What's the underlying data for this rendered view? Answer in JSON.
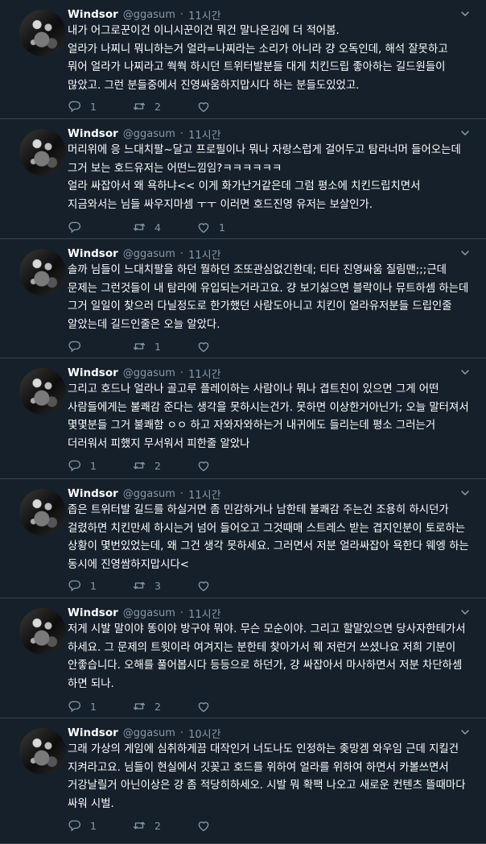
{
  "tweets": [
    {
      "name": "Windsor",
      "handle": "@ggasum",
      "dot": "·",
      "time": "11시간",
      "lines": [
        "내가 어그로꾼이건 이니시꾼이건 뭐건 말나온김에 더 적어봄.",
        "얼라가 나찌니 뭐니하는거 얼라=나찌라는 소리가 아니라 걍 오독인데, 해석 잘못하고 뭐어 얼라가 나찌라고 쒁쒁 하시던 트위터발분들 대게 치킨드립 좋아하는 길드원들이 많았고. 그런 분들중에서 진영싸움하지맙시다 하는 분들도있었고."
      ],
      "reply": "1",
      "retweet": "2",
      "like": ""
    },
    {
      "name": "Windsor",
      "handle": "@ggasum",
      "dot": "·",
      "time": "11시간",
      "lines": [
        "머리위에 응 느대치팔~달고 프로필이나 뭐나 자랑스럽게 걸어두고 탐라너머 들어오는데 그거 보는 호드유저는 어떤느낌임?ㅋㅋㅋㅋㅋㅋ",
        "얼라 싸잡아서 왜 욕하냐<< 이게 화가난거같은데 그럼 평소에 치킨드립치면서 지금와서는 님들 싸우지마셈 ㅜㅜ 이러면 호드진영 유저는 보살인가."
      ],
      "reply": "",
      "retweet": "4",
      "like": "1"
    },
    {
      "name": "Windsor",
      "handle": "@ggasum",
      "dot": "·",
      "time": "11시간",
      "lines": [
        "솔까 님들이 느대치팔을 하던 뭘하던 조또관심없긴한데; 티타 진영싸움 질림맨;;;근데 문제는 그런것들이 내 탐라에 유입되는거라고요. 걍 보기싫으면 블락이나 뮤트하셈 하는데 그거 일일이 찾으러 다닐정도로 한가했던 사람도아니고 치킨이 얼라유저분들 드립인줄 알았는데 길드인줄은 오늘 알았다."
      ],
      "reply": "",
      "retweet": "1",
      "like": ""
    },
    {
      "name": "Windsor",
      "handle": "@ggasum",
      "dot": "·",
      "time": "11시간",
      "lines": [
        "그리고 호드나 얼라나 골고루 플레이하는 사람이나 뭐나 겹트친이 있으면 그게 어떤 사람들에게는 불쾌감 준다는 생각을 못하시는건가. 못하면 이상한거아닌가; 오늘 말터져서 몇몇분들 그거 불쾌함 ㅇㅇ 하고 자와자와하는거 내귀에도 들리는데 평소 그러는거 더러워서 피했지 무서워서 피한줄 알았나"
      ],
      "reply": "1",
      "retweet": "2",
      "like": ""
    },
    {
      "name": "Windsor",
      "handle": "@ggasum",
      "dot": "·",
      "time": "11시간",
      "lines": [
        "좁은 트위터발 길드를 하실거면 좀 민감하거나 남한테 불쾌감 주는건 조용히 하시던가 걸렸하면 치킨만세 하시는거 넘어 들어오고 그것때매 스트레스 받는 겹지인분이 토로하는 상황이 몇번있었는데, 왜 그건 생각 못하세요. 그러면서 저분 얼라싸잡아 욕한다 웨엥 하는 동시에 진영쌈하지맙시다<"
      ],
      "reply": "1",
      "retweet": "3",
      "like": ""
    },
    {
      "name": "Windsor",
      "handle": "@ggasum",
      "dot": "·",
      "time": "11시간",
      "lines": [
        "저게 시발 말이야 똥이야 방구야 뭐야. 무슨 모순이야. 그리고 할말있으면 당사자한테가서 하세요. 그 문제의 트윗이라 여겨지는 분한테 찾아가서 웨 저런거 쓰셨나요 저희 기분이 안좋습니다. 오해를 풀어봅시다 등등으로 하던가, 걍 싸잡아서 마사하면서 저분 차단하셈 하면 되나."
      ],
      "reply": "1",
      "retweet": "2",
      "like": ""
    },
    {
      "name": "Windsor",
      "handle": "@ggasum",
      "dot": "·",
      "time": "10시간",
      "lines": [
        "그래 가상의 게임에 심취하게끔 대작인거 너도나도 인정하는 좆망겜 와우임 근데 지킬건 지켜라고요. 님들이 현실에서 깃꽂고 호드를 위하여 얼라를 위하여 하면서 카볼쓰면서 거강날릴거 아닌이상은 걍 좀 적당히하세오. 시발 뭐 확팩 나오고 새로운 컨텐츠 뜰때마다 싸워 시벌."
      ],
      "reply": "1",
      "retweet": "2",
      "like": ""
    }
  ]
}
